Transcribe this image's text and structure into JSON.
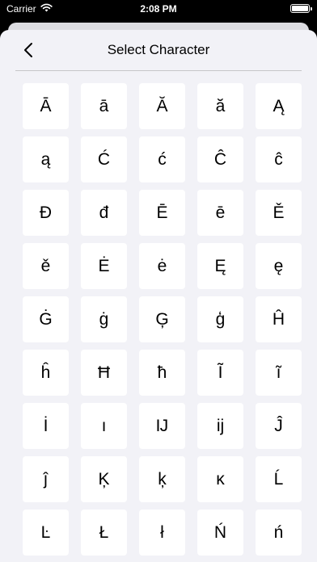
{
  "status_bar": {
    "carrier": "Carrier",
    "time": "2:08 PM"
  },
  "nav": {
    "title": "Select Character",
    "back_icon": "chevron-left-icon"
  },
  "characters": [
    "Ā",
    "ā",
    "Ă",
    "ă",
    "Ą",
    "ą",
    "Ć",
    "ć",
    "Ĉ",
    "ĉ",
    "Đ",
    "đ",
    "Ē",
    "ē",
    "Ě",
    "ě",
    "Ė",
    "ė",
    "Ę",
    "ę",
    "Ġ",
    "ġ",
    "Ģ",
    "ģ",
    "Ĥ",
    "ĥ",
    "Ħ",
    "ħ",
    "Ĩ",
    "ĩ",
    "İ",
    "ı",
    "Ĳ",
    "ĳ",
    "Ĵ",
    "ĵ",
    "Ķ",
    "ķ",
    "ĸ",
    "Ĺ",
    "Ŀ",
    "Ł",
    "ł",
    "Ń",
    "ń"
  ],
  "colors": {
    "background": "#f2f2f7",
    "cell": "#ffffff",
    "divider": "#c6c6c8"
  }
}
